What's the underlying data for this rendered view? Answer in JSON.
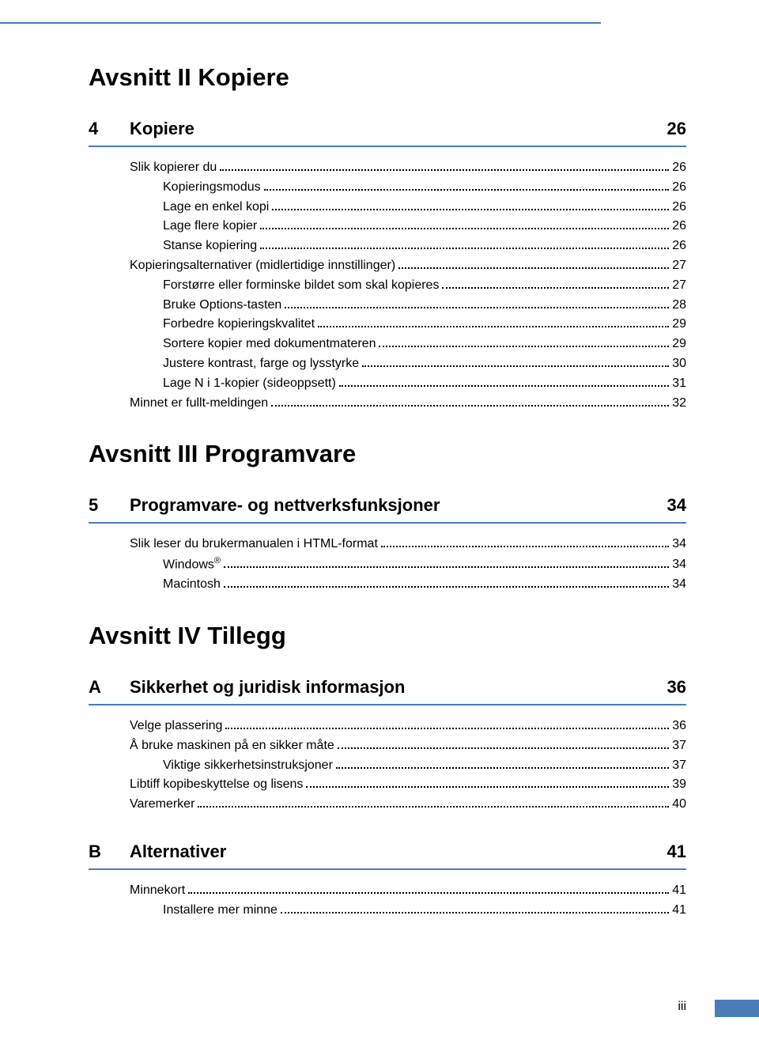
{
  "page_number_label": "iii",
  "sections": [
    {
      "title": "Avsnitt II   Kopiere",
      "chapters": [
        {
          "num": "4",
          "title": "Kopiere",
          "page": "26",
          "entries": [
            {
              "indent": 1,
              "label": "Slik kopierer du",
              "page": "26"
            },
            {
              "indent": 2,
              "label": "Kopieringsmodus",
              "page": "26"
            },
            {
              "indent": 2,
              "label": "Lage en enkel kopi",
              "page": "26"
            },
            {
              "indent": 2,
              "label": "Lage flere kopier",
              "page": "26"
            },
            {
              "indent": 2,
              "label": "Stanse kopiering",
              "page": "26"
            },
            {
              "indent": 1,
              "label": "Kopieringsalternativer (midlertidige innstillinger)",
              "page": "27"
            },
            {
              "indent": 2,
              "label": "Forstørre eller forminske bildet som skal kopieres",
              "page": "27"
            },
            {
              "indent": 2,
              "label": "Bruke Options-tasten",
              "page": "28"
            },
            {
              "indent": 2,
              "label": "Forbedre kopieringskvalitet",
              "page": "29"
            },
            {
              "indent": 2,
              "label": "Sortere kopier med dokumentmateren",
              "page": "29"
            },
            {
              "indent": 2,
              "label": "Justere kontrast, farge og lysstyrke",
              "page": "30"
            },
            {
              "indent": 2,
              "label": "Lage N i 1-kopier (sideoppsett)",
              "page": "31"
            },
            {
              "indent": 1,
              "label": "Minnet er fullt-meldingen",
              "page": "32"
            }
          ]
        }
      ]
    },
    {
      "title": "Avsnitt III  Programvare",
      "chapters": [
        {
          "num": "5",
          "title": "Programvare- og nettverksfunksjoner",
          "page": "34",
          "entries": [
            {
              "indent": 1,
              "label": "Slik leser du brukermanualen i HTML-format",
              "page": "34"
            },
            {
              "indent": 2,
              "label_html": "Windows<sup>®</sup>",
              "label": "Windows®",
              "page": "34"
            },
            {
              "indent": 2,
              "label": "Macintosh",
              "page": "34"
            }
          ]
        }
      ]
    },
    {
      "title": "Avsnitt IV  Tillegg",
      "chapters": [
        {
          "num": "A",
          "title": "Sikkerhet og juridisk informasjon",
          "page": "36",
          "entries": [
            {
              "indent": 1,
              "label": "Velge plassering",
              "page": "36"
            },
            {
              "indent": 1,
              "label": "Å bruke maskinen på en sikker måte",
              "page": "37"
            },
            {
              "indent": 2,
              "label": "Viktige sikkerhetsinstruksjoner",
              "page": "37"
            },
            {
              "indent": 1,
              "label": "Libtiff kopibeskyttelse og lisens",
              "page": "39"
            },
            {
              "indent": 1,
              "label": "Varemerker",
              "page": "40"
            }
          ]
        },
        {
          "num": "B",
          "title": "Alternativer",
          "page": "41",
          "entries": [
            {
              "indent": 1,
              "label": "Minnekort",
              "page": "41"
            },
            {
              "indent": 2,
              "label": "Installere mer minne",
              "page": "41"
            }
          ]
        }
      ]
    }
  ]
}
